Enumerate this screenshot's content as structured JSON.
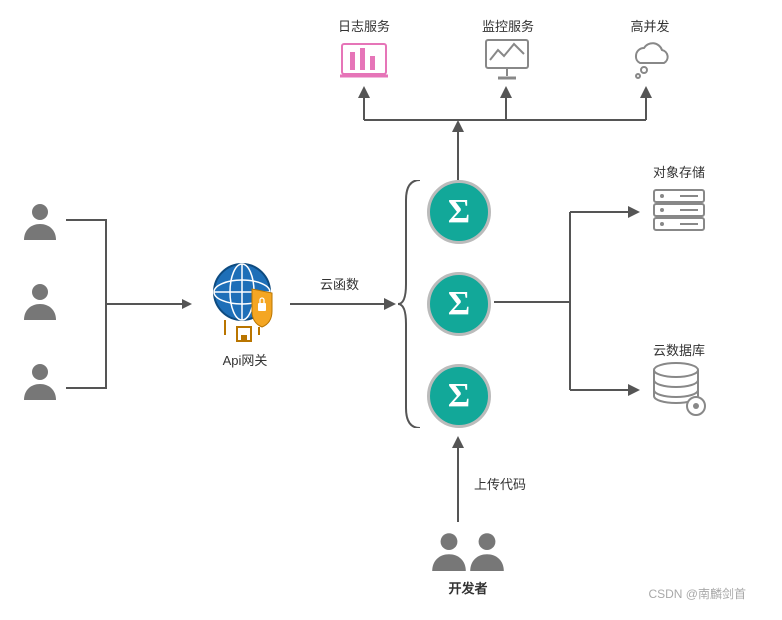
{
  "gateway": {
    "label": "Api网关"
  },
  "functions": {
    "label": "云函数"
  },
  "top": {
    "log": "日志服务",
    "monitoring": "监控服务",
    "concurrency": "高并发"
  },
  "right": {
    "storage": "对象存储",
    "database": "云数据库"
  },
  "developer": {
    "upload": "上传代码",
    "label": "开发者"
  },
  "misc": {
    "watermark": "CSDN @南麟剑首"
  },
  "colors": {
    "sigma_bg": "#12a899",
    "line": "#555555",
    "log_icon": "#e675b8",
    "globe": "#1e6fb8",
    "shield": "#f4a623",
    "grey_icon": "#888888"
  }
}
